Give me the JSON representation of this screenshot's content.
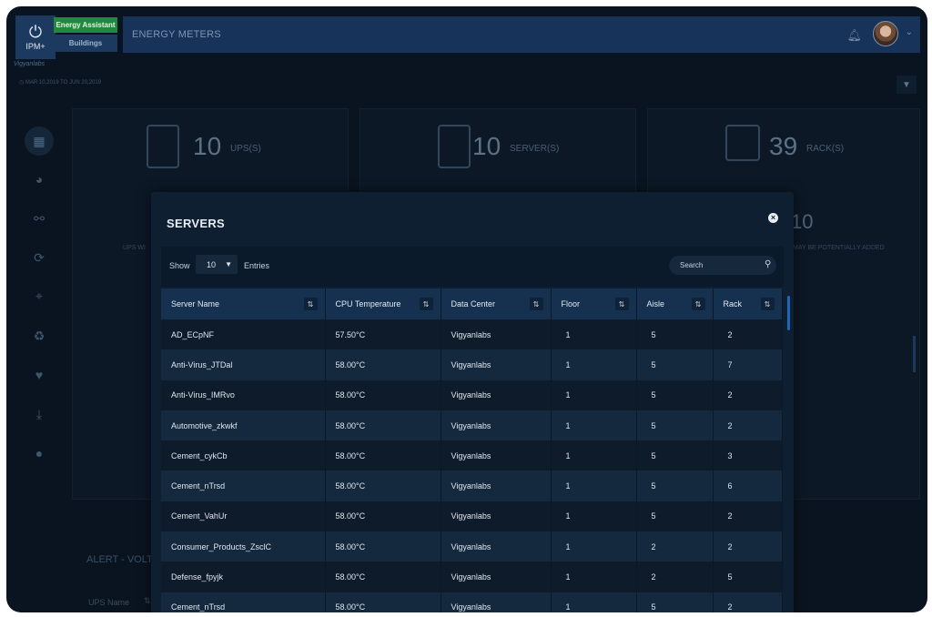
{
  "app": {
    "logo_glyph": "⏻",
    "logo_text": "IPM+",
    "logo_subtext": "Vigyanlabs",
    "energy_btn": "Energy Assistant",
    "buildings_btn": "Buildings",
    "header_title": "ENERGY METERS"
  },
  "date_range": "MAR 10,2019 TO JUN 20,2019",
  "sidebar": [
    {
      "icon": "dashboard-icon",
      "glyph": "▦"
    },
    {
      "icon": "pie-chart-icon",
      "glyph": "◕"
    },
    {
      "icon": "hierarchy-icon",
      "glyph": "⚯"
    },
    {
      "icon": "sync-icon",
      "glyph": "⟳"
    },
    {
      "icon": "map-icon",
      "glyph": "⌖"
    },
    {
      "icon": "recycle-icon",
      "glyph": "♻"
    },
    {
      "icon": "heartbeat-icon",
      "glyph": "♥"
    },
    {
      "icon": "download-icon",
      "glyph": "⤓"
    },
    {
      "icon": "user-icon",
      "glyph": "●"
    }
  ],
  "stats": {
    "ups": {
      "count": "10",
      "label": "UPS(S)"
    },
    "server": {
      "count": "10",
      "label": "SERVER(S)"
    },
    "rack": {
      "count": "39",
      "label": "RACK(S)"
    },
    "ups_note": "UPS WI",
    "rack_note": "MAY BE POTENTIALLY ADDED",
    "rack_extra": "10"
  },
  "alert": {
    "title": "ALERT - VOLT",
    "col": "UPS Name"
  },
  "modal": {
    "title": "SERVERS",
    "close": "×",
    "show_label": "Show",
    "entries_value": "10",
    "entries_label": "Entries",
    "search_placeholder": "Search",
    "columns": [
      "Server Name",
      "CPU Temperature",
      "Data Center",
      "Floor",
      "Aisle",
      "Rack"
    ],
    "rows": [
      [
        "AD_ECpNF",
        "57.50°C",
        "Vigyanlabs",
        "1",
        "5",
        "2"
      ],
      [
        "Anti-Virus_JTDal",
        "58.00°C",
        "Vigyanlabs",
        "1",
        "5",
        "7"
      ],
      [
        "Anti-Virus_IMRvo",
        "58.00°C",
        "Vigyanlabs",
        "1",
        "5",
        "2"
      ],
      [
        "Automotive_zkwkf",
        "58.00°C",
        "Vigyanlabs",
        "1",
        "5",
        "2"
      ],
      [
        "Cement_cykCb",
        "58.00°C",
        "Vigyanlabs",
        "1",
        "5",
        "3"
      ],
      [
        "Cement_nTrsd",
        "58.00°C",
        "Vigyanlabs",
        "1",
        "5",
        "6"
      ],
      [
        "Cement_VahUr",
        "58.00°C",
        "Vigyanlabs",
        "1",
        "5",
        "2"
      ],
      [
        "Consumer_Products_ZsclC",
        "58.00°C",
        "Vigyanlabs",
        "1",
        "2",
        "2"
      ],
      [
        "Defense_fpyjk",
        "58.00°C",
        "Vigyanlabs",
        "1",
        "2",
        "5"
      ],
      [
        "Cement_nTrsd",
        "58.00°C",
        "Vigyanlabs",
        "1",
        "5",
        "2"
      ]
    ]
  }
}
